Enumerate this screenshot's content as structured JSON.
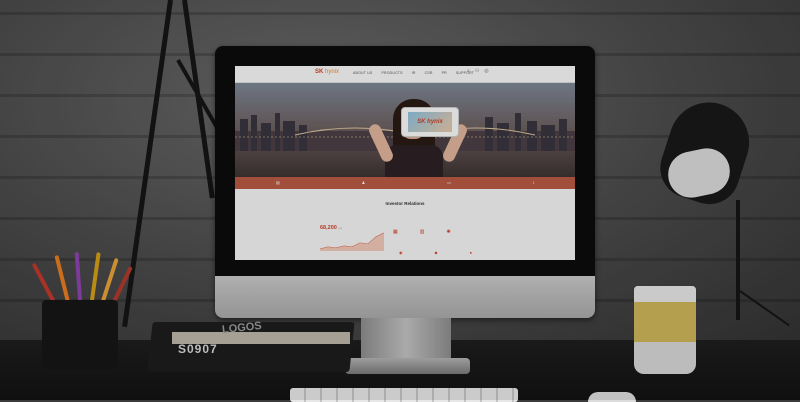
{
  "site": {
    "logo": {
      "brand": "SK",
      "name": "hynix"
    },
    "nav": [
      "ABOUT US",
      "PRODUCTS",
      "IR",
      "CSR",
      "PR",
      "SUPPORT"
    ],
    "util_icons": [
      {
        "icon": "search-icon",
        "glyph": "⌕"
      },
      {
        "icon": "user-icon",
        "glyph": "⚇"
      },
      {
        "icon": "globe-icon",
        "glyph": "◎"
      }
    ],
    "hero": {
      "phone_text": "SK hynix"
    },
    "strip_icons": [
      {
        "icon": "chart-icon",
        "glyph": "▤"
      },
      {
        "icon": "person-icon",
        "glyph": "♟"
      },
      {
        "icon": "document-icon",
        "glyph": "▭"
      },
      {
        "icon": "info-icon",
        "glyph": "ⅰ"
      }
    ],
    "investor_relations": {
      "title": "Investor Relations",
      "stock_price": "68,200",
      "stock_unit": "(+)"
    },
    "ir_icons": [
      {
        "icon": "calendar-icon",
        "glyph": "▦"
      },
      {
        "icon": "report-icon",
        "glyph": "▥"
      },
      {
        "icon": "gear-icon",
        "glyph": "✺"
      }
    ],
    "ir_icons_row2": [
      "◉",
      "◆",
      "●"
    ]
  },
  "props": {
    "book_spine": "S0907",
    "book_cover": "LOGOS"
  },
  "colors": {
    "brand_red": "#d2452a",
    "strip": "#b85a44",
    "mug_band": "#cdb65a"
  }
}
